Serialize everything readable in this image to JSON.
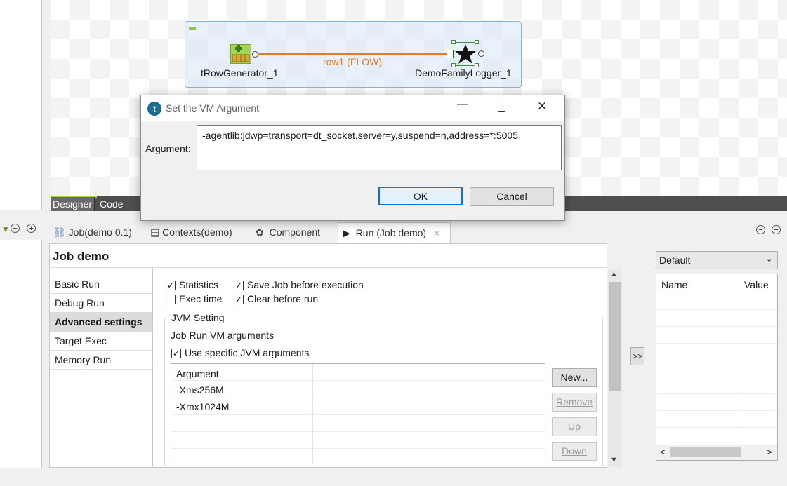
{
  "canvas": {
    "nodes": {
      "generator_label": "tRowGenerator_1",
      "logger_label": "DemoFamilyLogger_1"
    },
    "flow_label": "row1 (FLOW)",
    "view_tabs": [
      "Designer",
      "Code"
    ]
  },
  "bottom_tabs": [
    {
      "label": "Job(demo 0.1)",
      "icon": "job-icon"
    },
    {
      "label": "Contexts(demo)",
      "icon": "contexts-icon"
    },
    {
      "label": "Component",
      "icon": "palette-icon"
    },
    {
      "label": "Run (Job demo)",
      "icon": "run-icon",
      "active": true
    }
  ],
  "run_panel": {
    "title": "Job demo",
    "nav": [
      "Basic Run",
      "Debug Run",
      "Advanced settings",
      "Target Exec",
      "Memory Run"
    ],
    "selected_nav": "Advanced settings",
    "checkboxes": {
      "statistics": {
        "label": "Statistics",
        "checked": true
      },
      "save_job": {
        "label": "Save Job before execution",
        "checked": true
      },
      "exec_time": {
        "label": "Exec time",
        "checked": false
      },
      "clear_before": {
        "label": "Clear before run",
        "checked": true
      }
    },
    "jvm": {
      "group_title": "JVM Setting",
      "subtitle": "Job Run VM arguments",
      "use_specific": {
        "label": "Use specific JVM arguments",
        "checked": true
      },
      "table_header": "Argument",
      "rows": [
        "-Xms256M",
        "-Xmx1024M"
      ],
      "buttons": {
        "new": "New...",
        "remove": "Remove",
        "up": "Up",
        "down": "Down"
      }
    },
    "expand_label": ">>"
  },
  "context_panel": {
    "select_value": "Default",
    "columns": [
      "Name",
      "Value"
    ]
  },
  "dialog": {
    "title": "Set the VM Argument",
    "field_label": "Argument:",
    "value": "-agentlib:jdwp=transport=dt_socket,server=y,suspend=n,address=*:5005",
    "ok": "OK",
    "cancel": "Cancel"
  },
  "check_glyph": "✓",
  "colors": {
    "accent": "#a5d455",
    "flow": "#e07b2f",
    "dialog_ok_border": "#0078d7"
  }
}
